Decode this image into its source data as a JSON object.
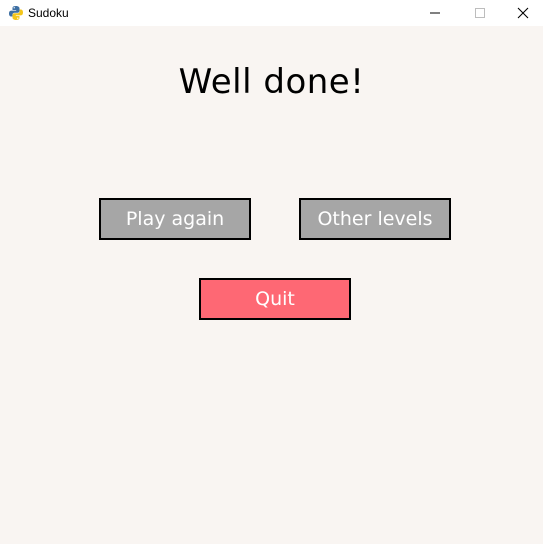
{
  "window": {
    "title": "Sudoku",
    "app_icon": "python-snake-icon",
    "controls": [
      "minimize-icon",
      "maximize-icon",
      "close-icon"
    ]
  },
  "screen": {
    "headline": "Well done!",
    "buttons": {
      "play_again": "Play again",
      "other_levels": "Other levels",
      "quit": "Quit"
    }
  },
  "colors": {
    "background": "#f9f5f2",
    "button_grey": "#a6a6a6",
    "button_red": "#fe6874",
    "button_text": "#ffffff",
    "border": "#000000"
  }
}
